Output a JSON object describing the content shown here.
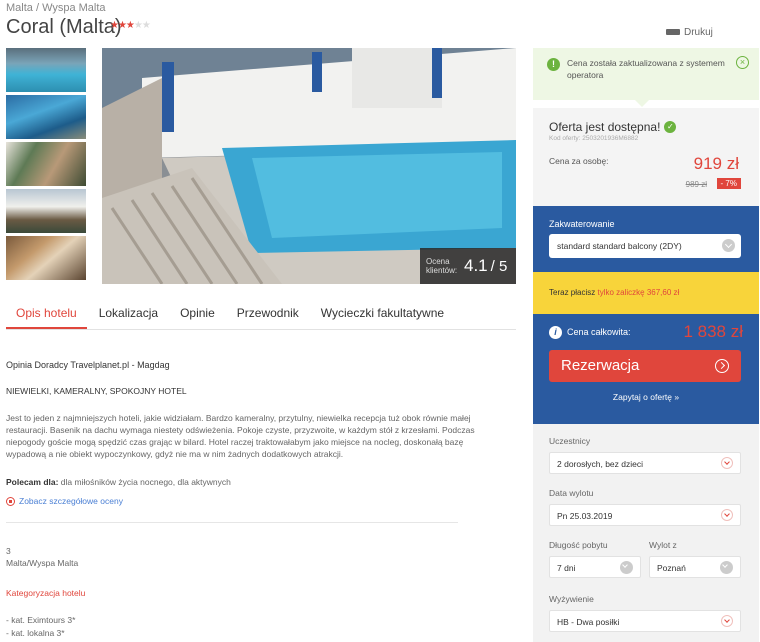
{
  "breadcrumb": "Malta / Wyspa Malta",
  "hotel": {
    "name": "Coral (Malta)",
    "stars_on": "★★★",
    "stars_off": "★★",
    "star_rating": 3
  },
  "print_label": "Drukuj",
  "rating": {
    "label": "Ocena klientów:",
    "score": "4.1",
    "max": "/ 5"
  },
  "tabs": [
    "Opis hotelu",
    "Lokalizacja",
    "Opinie",
    "Przewodnik",
    "Wycieczki fakultatywne"
  ],
  "content": {
    "advisor": "Opinia Doradcy Travelplanet.pl - Magdag",
    "headline": "NIEWIELKI, KAMERALNY, SPOKOJNY HOTEL",
    "review": "Jest to jeden z najmniejszych hoteli, jakie widziałam. Bardzo kameralny, przytulny, niewielka recepcja tuż obok równie małej restauracji. Basenik na dachu wymaga niestety odświeżenia. Pokoje czyste, przyzwoite, w każdym stół z krzesłami. Podczas niepogody goście mogą spędzić czas grając w bilard. Hotel raczej traktowałabym jako miejsce na nocleg, doskonałą bazę wypadową a nie obiekt wypoczynkowy, gdyż nie ma w nim żadnych dodatkowych atrakcji.",
    "recommend_label": "Polecam dla:",
    "recommend_text": " dla miłośników życia nocnego, dla aktywnych",
    "details_link": "Zobacz szczegółowe oceny",
    "meta_num": "3",
    "meta_loc": "Malta/Wyspa Malta",
    "category_title": "Kategoryzacja hotelu",
    "category_1": "- kat. Eximtours 3*",
    "category_2": "- kat. lokalna 3*"
  },
  "notice": {
    "text": "Cena została zaktualizowana z systemem operatora",
    "icon": "!",
    "close": "×"
  },
  "offer": {
    "title": "Oferta jest dostępna!",
    "check": "✓",
    "code": "Kod oferty: 2503201936M6882",
    "price_label": "Cena za osobę:",
    "price": "919 zł",
    "old_price": "989 zł",
    "discount": "- 7%"
  },
  "accommodation": {
    "label": "Zakwaterowanie",
    "value": "standard standard balcony (2DY)"
  },
  "deposit": {
    "prefix": "Teraz płacisz ",
    "highlight": "tylko zaliczkę 367,60 zł"
  },
  "total": {
    "icon": "i",
    "label": "Cena całkowita:",
    "price": "1 838 zł"
  },
  "reserve_label": "Rezerwacja",
  "ask_label": "Zapytaj o ofertę »",
  "filters": {
    "participants_label": "Uczestnicy",
    "participants_value": "2 dorosłych, bez dzieci",
    "date_label": "Data wylotu",
    "date_value": "Pn 25.03.2019",
    "duration_label": "Długość pobytu",
    "duration_value": "7 dni",
    "from_label": "Wylot z",
    "from_value": "Poznań",
    "board_label": "Wyżywienie",
    "board_value": "HB - Dwa posiłki"
  },
  "colors": {
    "accent": "#e0463c",
    "blue": "#2a5aa0",
    "yellow": "#f8d43a",
    "green": "#6cb33f"
  }
}
